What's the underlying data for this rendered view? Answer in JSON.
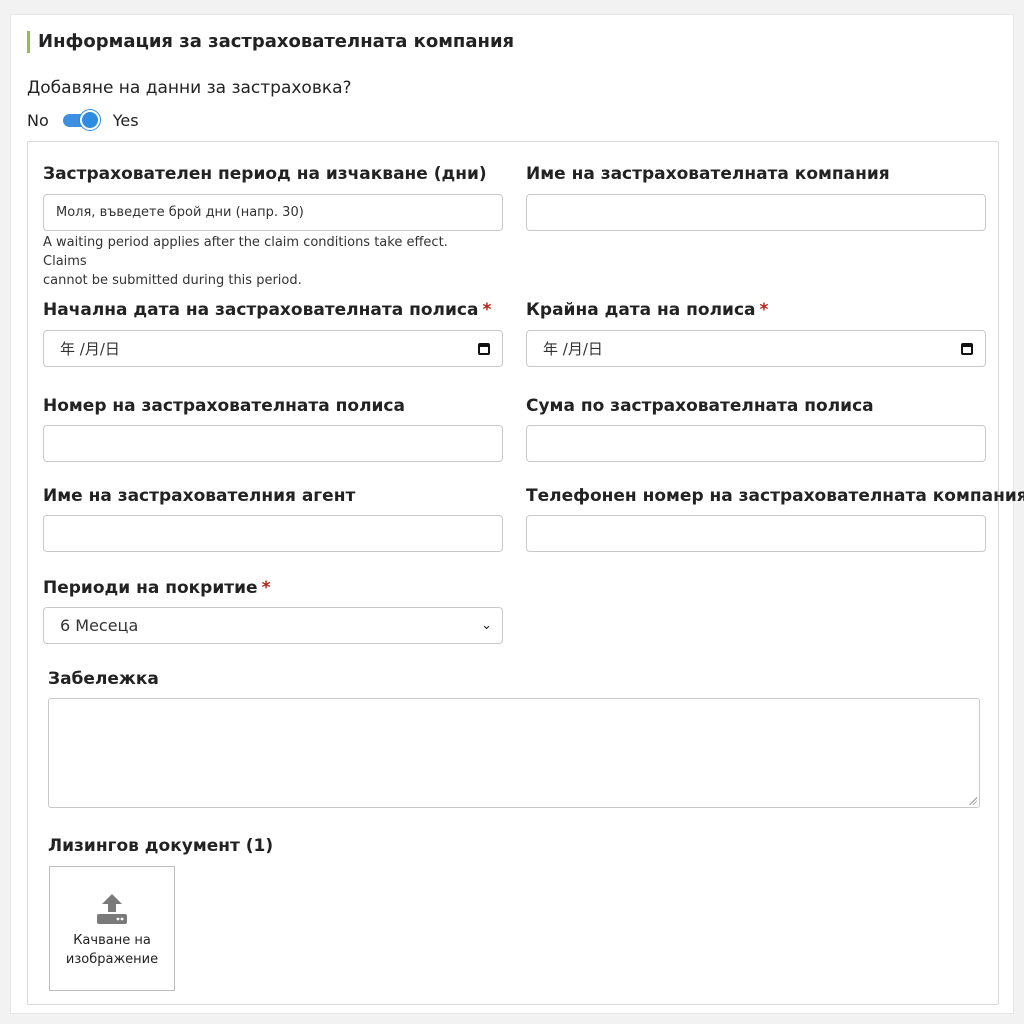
{
  "section_title": "Информация за застрахователната компания",
  "insurance_question": "Добавяне на данни за застраховка?",
  "toggle": {
    "off_label": "No",
    "on_label": "Yes",
    "checked": true
  },
  "fields": {
    "waiting_period": {
      "label": "Застрахователен период на изчакване (дни)",
      "placeholder": "Моля, въведете брой дни (напр. 30)",
      "help_line1": "A waiting period applies after the claim conditions take effect. Claims",
      "help_line2": "cannot be submitted during this period."
    },
    "company_name": {
      "label": "Име на застрахователната компания",
      "value": ""
    },
    "policy_start": {
      "label": "Начална дата на застрахователната полиса",
      "required": "*",
      "placeholder": "年 /月/日"
    },
    "policy_end": {
      "label": "Крайна дата на полиса",
      "required": "*",
      "placeholder": "年 /月/日"
    },
    "policy_number": {
      "label": "Номер на застрахователната полиса",
      "value": ""
    },
    "policy_amount": {
      "label": "Сума по застрахователната полиса",
      "value": ""
    },
    "agent_name": {
      "label": "Име на застрахователния агент",
      "value": ""
    },
    "company_phone": {
      "label": "Телефонен номер на застрахователната компания",
      "value": ""
    },
    "coverage_period": {
      "label": "Периоди на покритие",
      "required": "*",
      "selected": "6 Месеца"
    },
    "note": {
      "label": "Забележка",
      "value": ""
    },
    "lease_document": {
      "label": "Лизингов документ (1)",
      "upload_line1": "Качване на",
      "upload_line2": "изображение"
    }
  },
  "colors": {
    "accent_bar": "#8cc152",
    "toggle": "#2d8be0",
    "required": "#b42318"
  },
  "icons": {
    "date": "calendar-icon",
    "select": "chevron-down-icon",
    "upload": "upload-icon"
  }
}
